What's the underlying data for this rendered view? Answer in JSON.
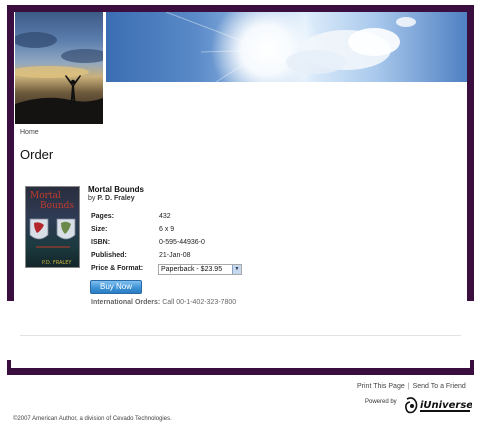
{
  "header": {
    "breadcrumb": "Home",
    "page_title": "Order"
  },
  "book": {
    "title": "Mortal Bounds",
    "by_label": "by",
    "author": "P. D. Fraley",
    "cover_alt": "Mortal Bounds book cover",
    "details": [
      {
        "label": "Pages:",
        "value": "432"
      },
      {
        "label": "Size:",
        "value": "6 x 9"
      },
      {
        "label": "ISBN:",
        "value": "0-595-44936-0"
      },
      {
        "label": "Published:",
        "value": "21-Jan-08"
      }
    ],
    "format_label": "Price & Format:",
    "format_selected": "Paperback - $23.95"
  },
  "buy_button_label": "Buy Now",
  "international": {
    "label": "International Orders:",
    "text": "Call 00-1-402-323-7800"
  },
  "footer": {
    "print_link": "Print This Page",
    "separator": "|",
    "send_link": "Send To a Friend",
    "powered_by": "Powered by",
    "logo_text": "iUniverse",
    "copyright": "©2007 American Author, a division of Cevado Technologies."
  },
  "colors": {
    "frame": "#3a0f3f",
    "button": "#3f93d6"
  }
}
